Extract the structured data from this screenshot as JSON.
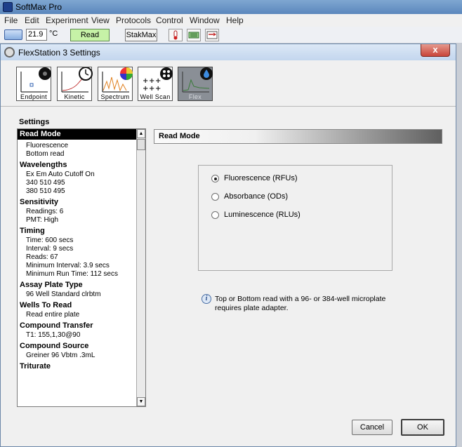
{
  "app": {
    "title": "SoftMax Pro",
    "menu": [
      "File",
      "Edit",
      "Experiment",
      "View",
      "Protocols",
      "Control",
      "Window",
      "Help"
    ]
  },
  "toolbar": {
    "temperature": "21.9",
    "temperature_unit": "°C",
    "read_label": "Read",
    "stakmax_label": "StakMax"
  },
  "dialog": {
    "title": "FlexStation 3 Settings",
    "close_glyph": "x",
    "modes": [
      {
        "label": "Endpoint",
        "selected": false
      },
      {
        "label": "Kinetic",
        "selected": false
      },
      {
        "label": "Spectrum",
        "selected": false
      },
      {
        "label": "Well Scan",
        "selected": false
      },
      {
        "label": "Flex",
        "selected": true
      }
    ],
    "settings_label": "Settings",
    "settings": {
      "selected": "Read Mode",
      "read_mode_lines": [
        "Fluorescence",
        "Bottom read"
      ],
      "wavelengths_title": "Wavelengths",
      "wavelengths_lines": [
        "Ex   Em   Auto Cutoff On",
        "340   510     495",
        "380   510     495"
      ],
      "sensitivity_title": "Sensitivity",
      "sensitivity_lines": [
        "Readings: 6",
        "PMT: High"
      ],
      "timing_title": "Timing",
      "timing_lines": [
        "Time: 600 secs",
        "Interval: 9 secs",
        "Reads: 67",
        "Minimum Interval: 3.9 secs",
        "Minimum Run Time: 112 secs"
      ],
      "assay_title": "Assay Plate Type",
      "assay_lines": [
        "96 Well Standard clrbtm"
      ],
      "wells_title": "Wells To Read",
      "wells_lines": [
        "Read entire plate"
      ],
      "compound_transfer_title": "Compound Transfer",
      "compound_transfer_lines": [
        "T1: 155,1,30@90"
      ],
      "compound_source_title": "Compound Source",
      "compound_source_lines": [
        "Greiner 96 Vbtm .3mL"
      ],
      "triturate_title": "Triturate"
    },
    "section_header": "Read Mode",
    "read_modes": [
      {
        "label": "Fluorescence (RFUs)",
        "checked": true
      },
      {
        "label": "Absorbance (ODs)",
        "checked": false
      },
      {
        "label": "Luminescence (RLUs)",
        "checked": false
      }
    ],
    "info": "Top or Bottom read with a 96- or 384-well microplate requires plate adapter.",
    "cancel_label": "Cancel",
    "ok_label": "OK"
  },
  "colors": {
    "read_button": "#c6f2a7",
    "selected_mode": "#8a8f96",
    "close_button": "#c8453a"
  }
}
